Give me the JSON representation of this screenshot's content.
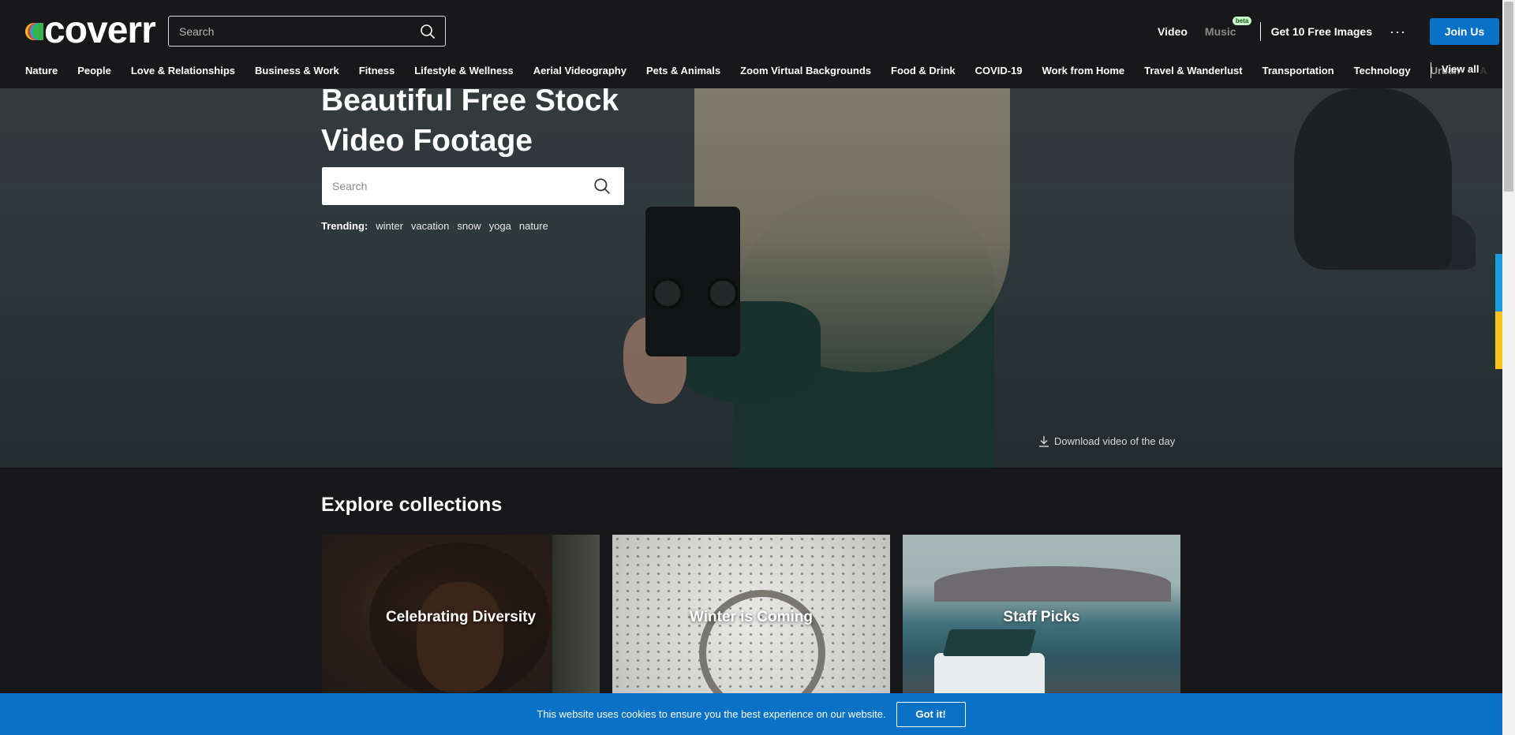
{
  "header": {
    "logo_text": "coverr",
    "search_placeholder": "Search",
    "nav": {
      "video": "Video",
      "music": "Music",
      "music_badge": "beta",
      "free_images": "Get 10 Free Images",
      "more": "···",
      "join": "Join Us"
    }
  },
  "categories": {
    "items": [
      "Nature",
      "People",
      "Love & Relationships",
      "Business & Work",
      "Fitness",
      "Lifestyle & Wellness",
      "Aerial Videography",
      "Pets & Animals",
      "Zoom Virtual Backgrounds",
      "Food & Drink",
      "COVID-19",
      "Work from Home",
      "Travel & Wanderlust",
      "Transportation",
      "Technology",
      "Urban",
      "A"
    ],
    "view_all": "View all"
  },
  "hero": {
    "title_line1": "Beautiful Free Stock",
    "title_line2": "Video Footage",
    "search_placeholder": "Search",
    "trending_label": "Trending:",
    "trending": [
      "winter",
      "vacation",
      "snow",
      "yoga",
      "nature"
    ],
    "download_label": "Download video of the day"
  },
  "collections": {
    "title": "Explore collections",
    "items": [
      "Celebrating Diversity",
      "Winter is Coming",
      "Staff Picks"
    ]
  },
  "cookie": {
    "text": "This website uses cookies to ensure you the best experience on our website.",
    "button": "Got it!"
  },
  "colors": {
    "background": "#18171a",
    "accent": "#0a72c6",
    "logo_stripes": [
      "#f7c31b",
      "#e4402f",
      "#2a9de0",
      "#35b34a"
    ]
  },
  "icons": {
    "search": "search-icon",
    "download": "download-icon",
    "more": "more-dots-icon"
  }
}
